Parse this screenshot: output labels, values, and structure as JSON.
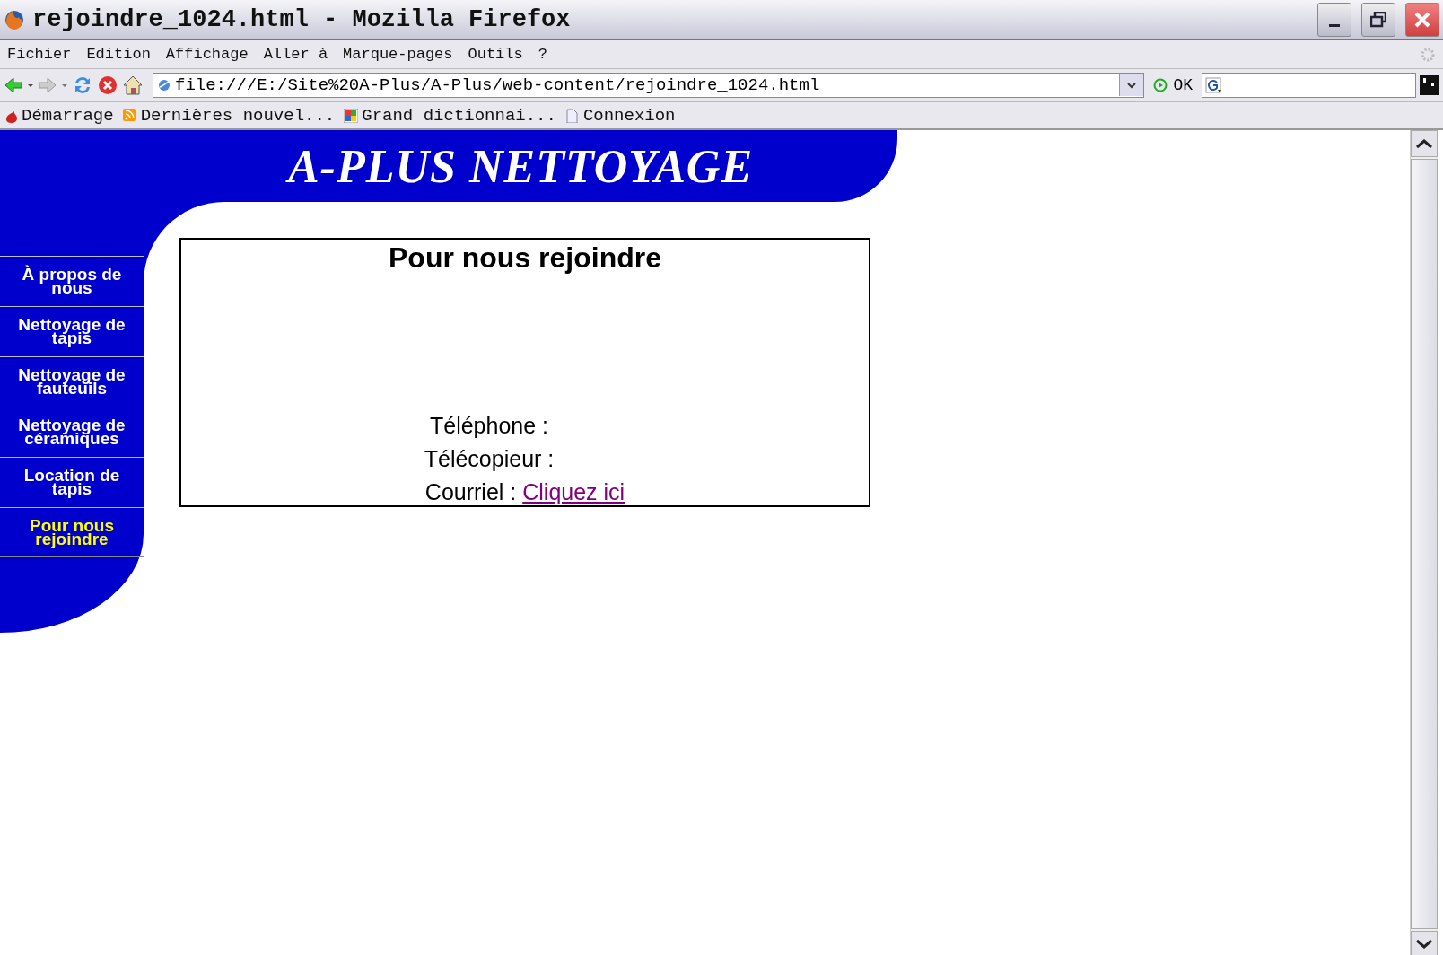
{
  "window": {
    "title": "rejoindre_1024.html - Mozilla Firefox"
  },
  "menu": [
    "Fichier",
    "Edition",
    "Affichage",
    "Aller à",
    "Marque-pages",
    "Outils",
    "?"
  ],
  "toolbar": {
    "address": "file:///E:/Site%20A-Plus/A-Plus/web-content/rejoindre_1024.html",
    "go_label": "OK"
  },
  "bookmarks": [
    "Démarrage",
    "Dernières nouvel...",
    "Grand dictionnai...",
    "Connexion"
  ],
  "site": {
    "title": "A-PLUS NETTOYAGE",
    "nav": [
      {
        "label": "À propos de nous",
        "selected": false
      },
      {
        "label": "Nettoyage de tapis",
        "selected": false
      },
      {
        "label": "Nettoyage de fauteuils",
        "selected": false
      },
      {
        "label": "Nettoyage de céramiques",
        "selected": false
      },
      {
        "label": "Location de tapis",
        "selected": false
      },
      {
        "label": "Pour nous rejoindre",
        "selected": true
      }
    ],
    "contact": {
      "heading": "Pour nous rejoindre",
      "lines": [
        {
          "label": "Téléphone :"
        },
        {
          "label": "Télécopieur :"
        },
        {
          "label": "Courriel :",
          "link": "Cliquez ici"
        }
      ]
    }
  }
}
